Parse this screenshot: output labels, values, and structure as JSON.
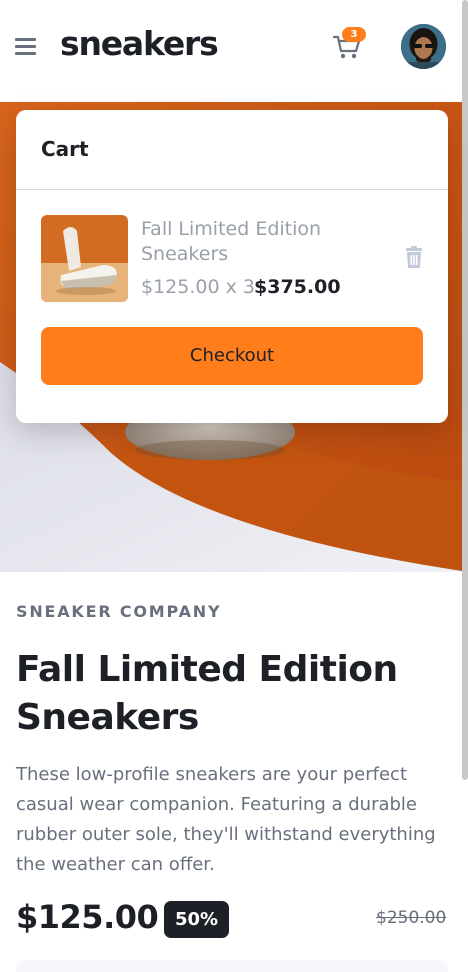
{
  "header": {
    "logo": "sneakers",
    "cart_count": "3"
  },
  "cart": {
    "title": "Cart",
    "item": {
      "name": "Fall Limited Edition Sneakers",
      "price_qty": "$125.00 x 3",
      "total": "$375.00"
    },
    "checkout_label": "Checkout"
  },
  "product": {
    "company": "SNEAKER COMPANY",
    "title": "Fall Limited Edition Sneakers",
    "description": "These low-profile sneakers are your perfect casual wear companion. Featuring a durable rubber outer sole, they'll withstand everything the weather can offer.",
    "price": "$125.00",
    "discount": "50%",
    "original_price": "$250.00"
  },
  "colors": {
    "accent": "#ff7e1b",
    "dark": "#1d2026",
    "muted": "#69707d"
  },
  "icons": [
    "menu-icon",
    "cart-icon",
    "trash-icon"
  ]
}
